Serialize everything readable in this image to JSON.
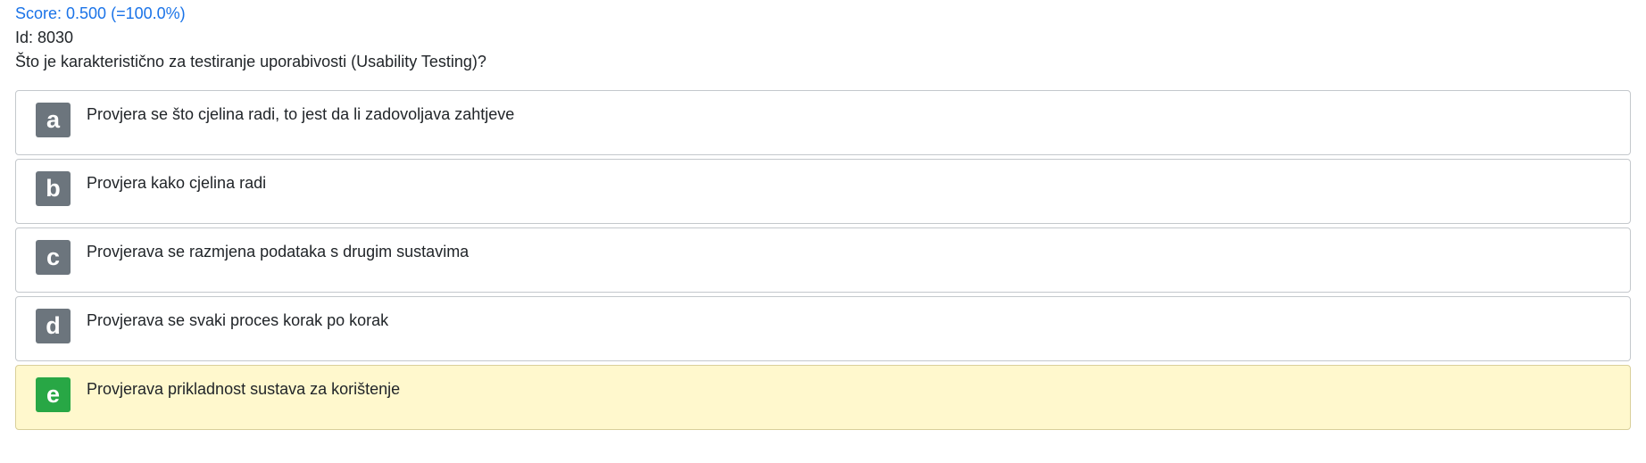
{
  "score_text": "Score: 0.500 (=100.0%)",
  "id_text": "Id: 8030",
  "question": "Što je karakteristično za testiranje uporabivosti (Usability Testing)?",
  "colors": {
    "score": "#1a73e8",
    "letter_default": "#6c757d",
    "letter_selected": "#28a745",
    "selected_background": "#fff8cd"
  },
  "options": [
    {
      "letter": "a",
      "text": "Provjera se što cjelina radi, to jest da li zadovoljava zahtjeve",
      "selected": false
    },
    {
      "letter": "b",
      "text": "Provjera kako cjelina radi",
      "selected": false
    },
    {
      "letter": "c",
      "text": "Provjerava se razmjena podataka s drugim sustavima",
      "selected": false
    },
    {
      "letter": "d",
      "text": "Provjerava se svaki proces korak po korak",
      "selected": false
    },
    {
      "letter": "e",
      "text": "Provjerava prikladnost sustava za korištenje",
      "selected": true
    }
  ]
}
